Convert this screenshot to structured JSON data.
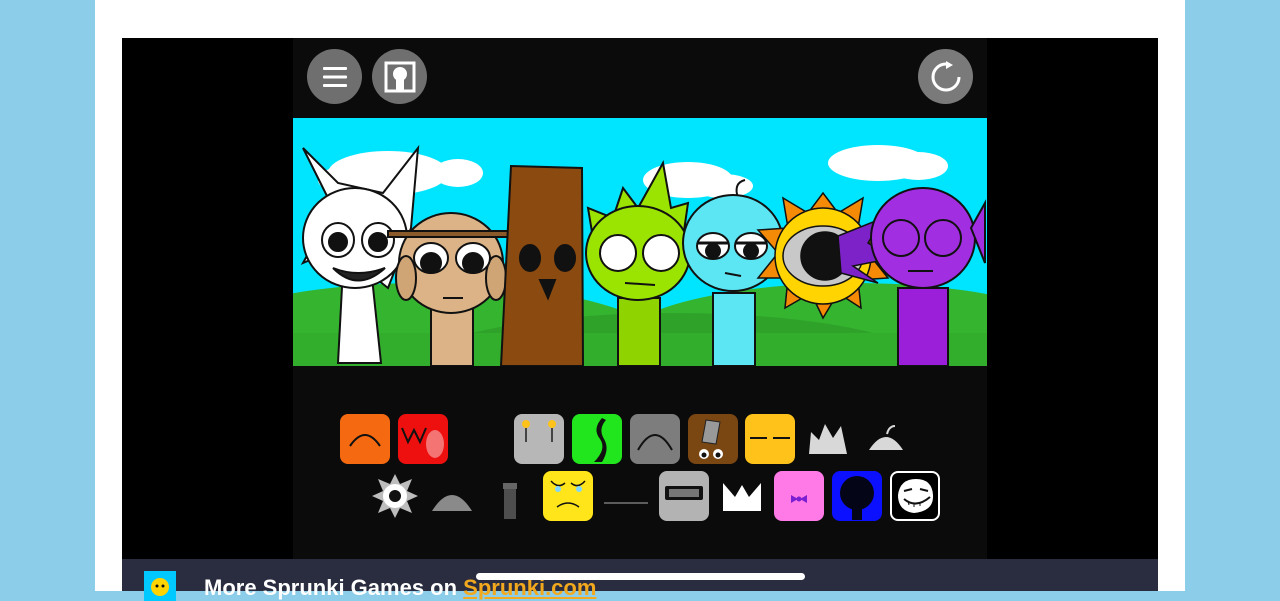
{
  "toolbar": {
    "menu_icon": "menu-icon",
    "character_icon": "character-icon",
    "reset_icon": "reset-icon"
  },
  "scene": {
    "characters": [
      "white",
      "tan",
      "brown",
      "lime",
      "cyan",
      "sun",
      "purple"
    ]
  },
  "sound_icons": {
    "row1": [
      "orange",
      "red",
      "gray-pins",
      "green",
      "gray",
      "brown-cup",
      "yellow",
      "crown",
      "dome"
    ],
    "row2": [
      "gear-eye",
      "half-dome",
      "tube",
      "yellow-face",
      "line",
      "visor",
      "white-crown",
      "pink-bow",
      "blue-dark",
      "troll-face"
    ]
  },
  "bottom_bar": {
    "text_prefix": "More Sprunki Games on ",
    "site_name": "Sprunki.com"
  }
}
